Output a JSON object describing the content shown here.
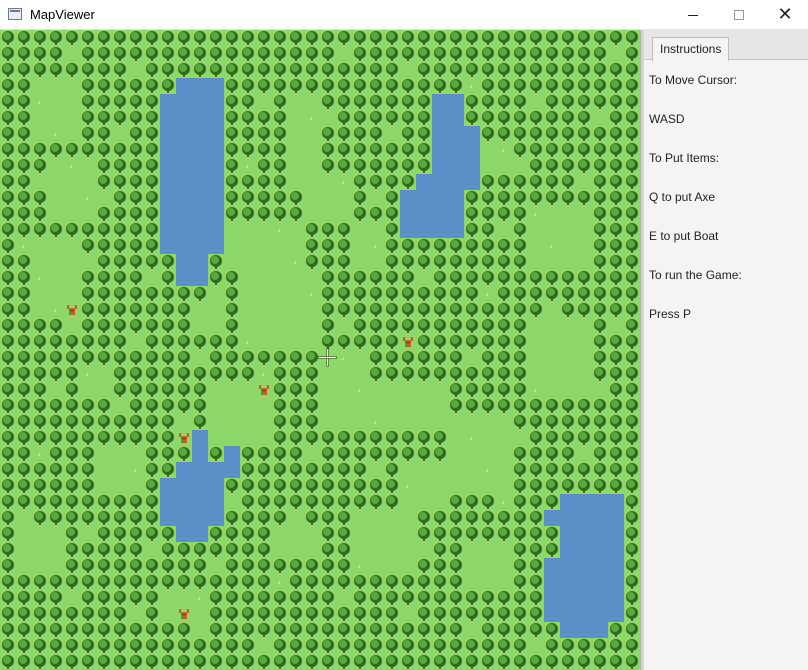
{
  "window": {
    "title": "MapViewer",
    "minimize_glyph": "—",
    "maximize_glyph": "☐",
    "close_glyph": "✕"
  },
  "map": {
    "grid_cols": 40,
    "grid_rows": 40,
    "cursor_icon": "crosshair-icon",
    "colors": {
      "grass": "#8ed86a",
      "grass_light": "#a6e47a",
      "water": "#5b8fc8",
      "tree_dark": "#2e6b1f",
      "tree_light": "#5aa83a",
      "trunk": "#6b4a2a",
      "stump": "#b5652a"
    }
  },
  "panel": {
    "tab_label": "Instructions",
    "lines": [
      "To Move Cursor:",
      "WASD",
      "To Put Items:",
      "Q to put Axe",
      "E to put Boat",
      "To run the Game:",
      "Press P"
    ]
  }
}
